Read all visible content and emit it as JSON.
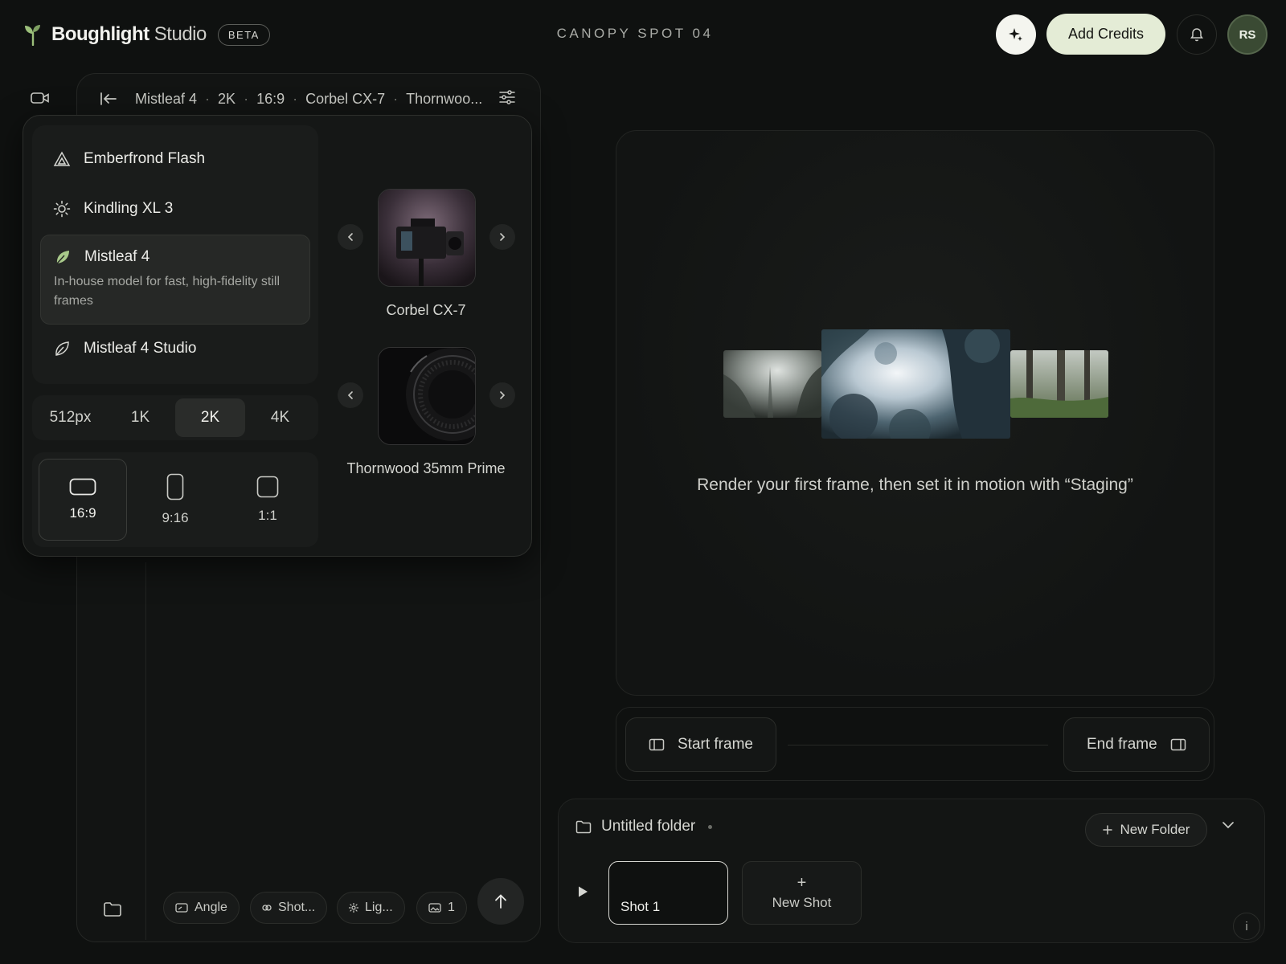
{
  "app": {
    "brand_bold": "Boughlight",
    "brand_light": "Studio",
    "beta_badge": "BETA",
    "project_title": "CANOPY SPOT 04",
    "add_credits_label": "Add Credits",
    "avatar_initials": "RS"
  },
  "breadcrumb": {
    "model": "Mistleaf 4",
    "resolution": "2K",
    "ratio": "16:9",
    "camera": "Corbel CX-7",
    "lens": "Thornwoo..."
  },
  "models": [
    {
      "label": "Emberfrond Flash",
      "icon": "triangle-icon"
    },
    {
      "label": "Kindling XL 3",
      "icon": "sun-icon"
    },
    {
      "label": "Mistleaf 4",
      "icon": "leaf-filled-icon",
      "description": "In-house model for fast, high-fidelity still frames",
      "selected": true
    },
    {
      "label": "Mistleaf 4 Studio",
      "icon": "leaf-outline-icon"
    }
  ],
  "resolutions": [
    {
      "label": "512px"
    },
    {
      "label": "1K"
    },
    {
      "label": "2K",
      "selected": true
    },
    {
      "label": "4K"
    }
  ],
  "ratios": [
    {
      "label": "16:9",
      "selected": true
    },
    {
      "label": "9:16"
    },
    {
      "label": "1:1"
    }
  ],
  "cameras": [
    {
      "label": "Corbel CX-7"
    },
    {
      "label": "Thornwood 35mm Prime"
    }
  ],
  "toolbar": {
    "angle": "Angle",
    "shot": "Shot...",
    "lighting": "Lig...",
    "image_count": "1"
  },
  "canvas": {
    "hint": "Render your first frame, then set it in motion with “Staging”",
    "start_frame": "Start frame",
    "end_frame": "End frame"
  },
  "shots": {
    "folder_name": "Untitled folder",
    "new_folder": "New Folder",
    "items": [
      {
        "label": "Shot 1"
      }
    ],
    "new_shot": "New Shot",
    "new_shot_plus": "+",
    "info": "i"
  },
  "colors": {
    "background": "#0f1110",
    "accent": "#e4ecd6",
    "brand_leaf": "#9bbf7a"
  }
}
